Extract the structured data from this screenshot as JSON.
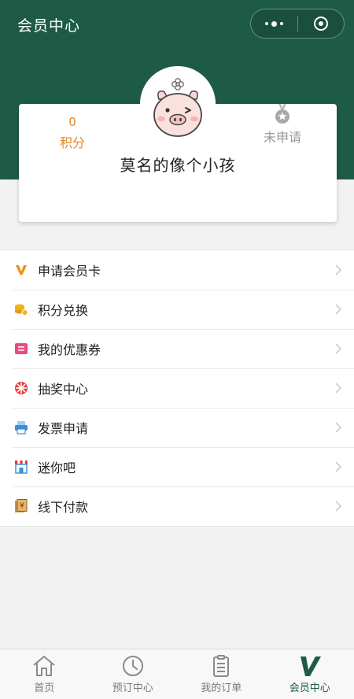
{
  "nav": {
    "title": "会员中心"
  },
  "profile": {
    "points_value": "0",
    "points_label": "积分",
    "medal_status": "未申请",
    "username": "莫名的像个小孩"
  },
  "menu": [
    {
      "icon": "v-badge-icon",
      "label": "申请会员卡"
    },
    {
      "icon": "coins-icon",
      "label": "积分兑换"
    },
    {
      "icon": "coupon-icon",
      "label": "我的优惠券"
    },
    {
      "icon": "lottery-wheel-icon",
      "label": "抽奖中心"
    },
    {
      "icon": "printer-icon",
      "label": "发票申请"
    },
    {
      "icon": "store-icon",
      "label": "迷你吧"
    },
    {
      "icon": "cash-receipt-icon",
      "label": "线下付款"
    }
  ],
  "tabs": [
    {
      "icon": "home-icon",
      "label": "首页",
      "active": false
    },
    {
      "icon": "clock-icon",
      "label": "预订中心",
      "active": false
    },
    {
      "icon": "clipboard-icon",
      "label": "我的订单",
      "active": false
    },
    {
      "icon": "v-logo-icon",
      "label": "会员中心",
      "active": true
    }
  ],
  "colors": {
    "brand_green": "#1e5b47",
    "points_orange": "#e08a2a"
  }
}
